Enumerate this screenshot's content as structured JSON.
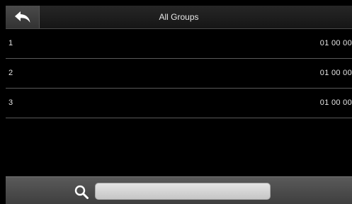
{
  "header": {
    "title": "All Groups",
    "back_icon": "back-arrow-icon"
  },
  "groups": [
    {
      "id": "1",
      "time": "01 00 00"
    },
    {
      "id": "2",
      "time": "01 00 00"
    },
    {
      "id": "3",
      "time": "01 00 00"
    }
  ],
  "search": {
    "icon": "search-icon",
    "value": "",
    "placeholder": ""
  },
  "colors": {
    "background": "#000000",
    "header": "#1e1e1e",
    "bottom_bar": "#4a4a4a",
    "text": "#e6e6e6",
    "divider": "#5a5a5a"
  }
}
